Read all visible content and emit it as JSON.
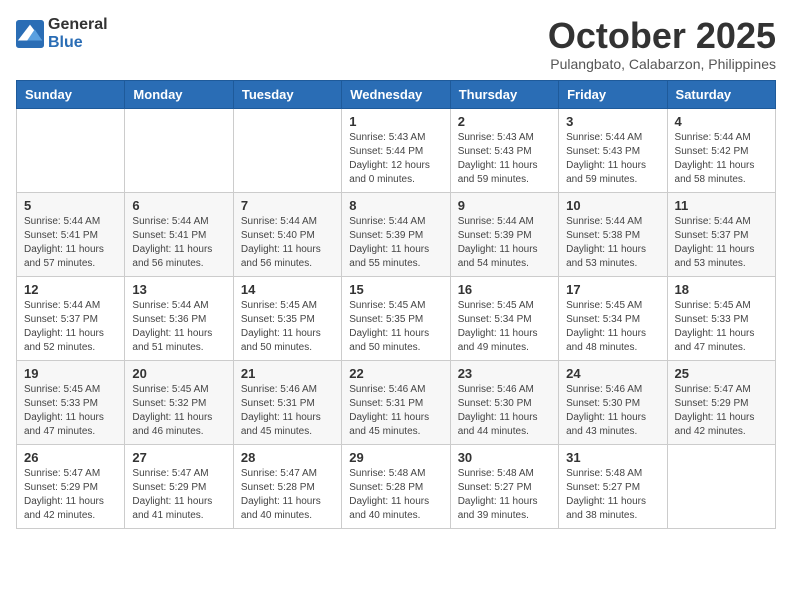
{
  "logo": {
    "general": "General",
    "blue": "Blue"
  },
  "title": "October 2025",
  "subtitle": "Pulangbato, Calabarzon, Philippines",
  "days_header": [
    "Sunday",
    "Monday",
    "Tuesday",
    "Wednesday",
    "Thursday",
    "Friday",
    "Saturday"
  ],
  "weeks": [
    [
      {
        "day": "",
        "info": ""
      },
      {
        "day": "",
        "info": ""
      },
      {
        "day": "",
        "info": ""
      },
      {
        "day": "1",
        "info": "Sunrise: 5:43 AM\nSunset: 5:44 PM\nDaylight: 12 hours\nand 0 minutes."
      },
      {
        "day": "2",
        "info": "Sunrise: 5:43 AM\nSunset: 5:43 PM\nDaylight: 11 hours\nand 59 minutes."
      },
      {
        "day": "3",
        "info": "Sunrise: 5:44 AM\nSunset: 5:43 PM\nDaylight: 11 hours\nand 59 minutes."
      },
      {
        "day": "4",
        "info": "Sunrise: 5:44 AM\nSunset: 5:42 PM\nDaylight: 11 hours\nand 58 minutes."
      }
    ],
    [
      {
        "day": "5",
        "info": "Sunrise: 5:44 AM\nSunset: 5:41 PM\nDaylight: 11 hours\nand 57 minutes."
      },
      {
        "day": "6",
        "info": "Sunrise: 5:44 AM\nSunset: 5:41 PM\nDaylight: 11 hours\nand 56 minutes."
      },
      {
        "day": "7",
        "info": "Sunrise: 5:44 AM\nSunset: 5:40 PM\nDaylight: 11 hours\nand 56 minutes."
      },
      {
        "day": "8",
        "info": "Sunrise: 5:44 AM\nSunset: 5:39 PM\nDaylight: 11 hours\nand 55 minutes."
      },
      {
        "day": "9",
        "info": "Sunrise: 5:44 AM\nSunset: 5:39 PM\nDaylight: 11 hours\nand 54 minutes."
      },
      {
        "day": "10",
        "info": "Sunrise: 5:44 AM\nSunset: 5:38 PM\nDaylight: 11 hours\nand 53 minutes."
      },
      {
        "day": "11",
        "info": "Sunrise: 5:44 AM\nSunset: 5:37 PM\nDaylight: 11 hours\nand 53 minutes."
      }
    ],
    [
      {
        "day": "12",
        "info": "Sunrise: 5:44 AM\nSunset: 5:37 PM\nDaylight: 11 hours\nand 52 minutes."
      },
      {
        "day": "13",
        "info": "Sunrise: 5:44 AM\nSunset: 5:36 PM\nDaylight: 11 hours\nand 51 minutes."
      },
      {
        "day": "14",
        "info": "Sunrise: 5:45 AM\nSunset: 5:35 PM\nDaylight: 11 hours\nand 50 minutes."
      },
      {
        "day": "15",
        "info": "Sunrise: 5:45 AM\nSunset: 5:35 PM\nDaylight: 11 hours\nand 50 minutes."
      },
      {
        "day": "16",
        "info": "Sunrise: 5:45 AM\nSunset: 5:34 PM\nDaylight: 11 hours\nand 49 minutes."
      },
      {
        "day": "17",
        "info": "Sunrise: 5:45 AM\nSunset: 5:34 PM\nDaylight: 11 hours\nand 48 minutes."
      },
      {
        "day": "18",
        "info": "Sunrise: 5:45 AM\nSunset: 5:33 PM\nDaylight: 11 hours\nand 47 minutes."
      }
    ],
    [
      {
        "day": "19",
        "info": "Sunrise: 5:45 AM\nSunset: 5:33 PM\nDaylight: 11 hours\nand 47 minutes."
      },
      {
        "day": "20",
        "info": "Sunrise: 5:45 AM\nSunset: 5:32 PM\nDaylight: 11 hours\nand 46 minutes."
      },
      {
        "day": "21",
        "info": "Sunrise: 5:46 AM\nSunset: 5:31 PM\nDaylight: 11 hours\nand 45 minutes."
      },
      {
        "day": "22",
        "info": "Sunrise: 5:46 AM\nSunset: 5:31 PM\nDaylight: 11 hours\nand 45 minutes."
      },
      {
        "day": "23",
        "info": "Sunrise: 5:46 AM\nSunset: 5:30 PM\nDaylight: 11 hours\nand 44 minutes."
      },
      {
        "day": "24",
        "info": "Sunrise: 5:46 AM\nSunset: 5:30 PM\nDaylight: 11 hours\nand 43 minutes."
      },
      {
        "day": "25",
        "info": "Sunrise: 5:47 AM\nSunset: 5:29 PM\nDaylight: 11 hours\nand 42 minutes."
      }
    ],
    [
      {
        "day": "26",
        "info": "Sunrise: 5:47 AM\nSunset: 5:29 PM\nDaylight: 11 hours\nand 42 minutes."
      },
      {
        "day": "27",
        "info": "Sunrise: 5:47 AM\nSunset: 5:29 PM\nDaylight: 11 hours\nand 41 minutes."
      },
      {
        "day": "28",
        "info": "Sunrise: 5:47 AM\nSunset: 5:28 PM\nDaylight: 11 hours\nand 40 minutes."
      },
      {
        "day": "29",
        "info": "Sunrise: 5:48 AM\nSunset: 5:28 PM\nDaylight: 11 hours\nand 40 minutes."
      },
      {
        "day": "30",
        "info": "Sunrise: 5:48 AM\nSunset: 5:27 PM\nDaylight: 11 hours\nand 39 minutes."
      },
      {
        "day": "31",
        "info": "Sunrise: 5:48 AM\nSunset: 5:27 PM\nDaylight: 11 hours\nand 38 minutes."
      },
      {
        "day": "",
        "info": ""
      }
    ]
  ]
}
